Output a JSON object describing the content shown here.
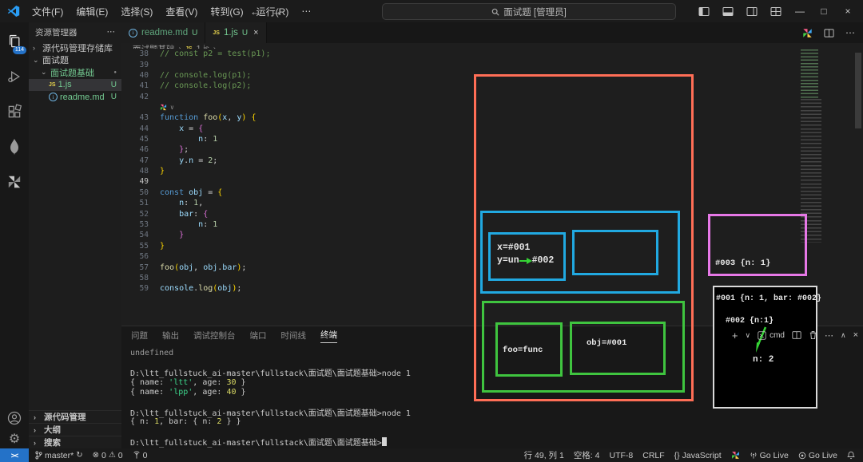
{
  "title_bar": {
    "menus": [
      "文件(F)",
      "编辑(E)",
      "选择(S)",
      "查看(V)",
      "转到(G)",
      "运行(R)",
      "⋯"
    ],
    "search_label": "面试题 [管理员]"
  },
  "icons": {
    "back": "←",
    "forward": "→",
    "more": "⋯",
    "chev_r": "›",
    "chev_d": "⌄",
    "vee": "∨",
    "caret": "∧",
    "close": "×",
    "minimize": "—",
    "maximize": "□",
    "plus": "+",
    "gear": "⚙",
    "warning": "⚠",
    "error": "⊗",
    "sync": "↻",
    "dot": "●",
    "js_badge": "JS",
    "info": "i"
  },
  "activity_bar": {
    "badge": "114"
  },
  "sidebar": {
    "header": "资源管理器",
    "tree": [
      {
        "id": "repos",
        "label": "源代码管理存储库",
        "arrow": "›",
        "depth": 0,
        "color": "gray"
      },
      {
        "id": "mianshiti",
        "label": "面试题",
        "arrow": "⌄",
        "depth": 0,
        "color": "light"
      },
      {
        "id": "mianshiti-jichu",
        "label": "面试题基础",
        "arrow": "⌄",
        "depth": 1,
        "color": "green",
        "dot": true
      },
      {
        "id": "1js",
        "label": "1.js",
        "icon": "js",
        "depth": 2,
        "color": "green",
        "badge": "U",
        "selected": true
      },
      {
        "id": "readme",
        "label": "readme.md",
        "icon": "info",
        "depth": 2,
        "color": "green",
        "badge": "U"
      }
    ],
    "bottom_sections": [
      "源代码管理",
      "大纲",
      "搜索"
    ]
  },
  "tabs": [
    {
      "label": "readme.md",
      "icon": "info",
      "badge": "U",
      "active": false
    },
    {
      "label": "1.js",
      "icon": "js",
      "badge": "U",
      "active": true
    }
  ],
  "breadcrumb": {
    "items": [
      "面试题基础",
      "1.js",
      "..."
    ],
    "sep": "›"
  },
  "editor": {
    "lines": [
      {
        "n": "38",
        "seg": [
          [
            "com",
            "// const p2 = test(p1);"
          ]
        ]
      },
      {
        "n": "39",
        "seg": []
      },
      {
        "n": "40",
        "seg": [
          [
            "com",
            "// console.log(p1);"
          ]
        ]
      },
      {
        "n": "41",
        "seg": [
          [
            "com",
            "// console.log(p2);"
          ]
        ]
      },
      {
        "n": "42",
        "seg": []
      },
      {
        "icon_row": true
      },
      {
        "n": "43",
        "seg": [
          [
            "kw",
            "function "
          ],
          [
            "fn",
            "foo"
          ],
          [
            "b1",
            "("
          ],
          [
            "var",
            "x"
          ],
          [
            "pun",
            ", "
          ],
          [
            "var",
            "y"
          ],
          [
            "b1",
            ")"
          ],
          [
            "pun",
            " "
          ],
          [
            "b1",
            "{"
          ]
        ]
      },
      {
        "n": "44",
        "seg": [
          [
            "pun",
            "    "
          ],
          [
            "var",
            "x"
          ],
          [
            "pun",
            " = "
          ],
          [
            "b2",
            "{"
          ]
        ]
      },
      {
        "n": "45",
        "seg": [
          [
            "pun",
            "        "
          ],
          [
            "var",
            "n"
          ],
          [
            "pun",
            ": "
          ],
          [
            "num",
            "1"
          ]
        ]
      },
      {
        "n": "46",
        "seg": [
          [
            "pun",
            "    "
          ],
          [
            "b2",
            "}"
          ],
          [
            "pun",
            ";"
          ]
        ]
      },
      {
        "n": "47",
        "seg": [
          [
            "pun",
            "    "
          ],
          [
            "var",
            "y"
          ],
          [
            "pun",
            "."
          ],
          [
            "var",
            "n"
          ],
          [
            "pun",
            " = "
          ],
          [
            "num",
            "2"
          ],
          [
            "pun",
            ";"
          ]
        ]
      },
      {
        "n": "48",
        "seg": [
          [
            "b1",
            "}"
          ]
        ]
      },
      {
        "n": "49",
        "seg": [],
        "active": true
      },
      {
        "n": "50",
        "seg": [
          [
            "kw",
            "const "
          ],
          [
            "var",
            "obj"
          ],
          [
            "pun",
            " = "
          ],
          [
            "b1",
            "{"
          ]
        ]
      },
      {
        "n": "51",
        "seg": [
          [
            "pun",
            "    "
          ],
          [
            "var",
            "n"
          ],
          [
            "pun",
            ": "
          ],
          [
            "num",
            "1"
          ],
          [
            "pun",
            ","
          ]
        ]
      },
      {
        "n": "52",
        "seg": [
          [
            "pun",
            "    "
          ],
          [
            "var",
            "bar"
          ],
          [
            "pun",
            ": "
          ],
          [
            "b2",
            "{"
          ]
        ]
      },
      {
        "n": "53",
        "seg": [
          [
            "pun",
            "        "
          ],
          [
            "var",
            "n"
          ],
          [
            "pun",
            ": "
          ],
          [
            "num",
            "1"
          ]
        ]
      },
      {
        "n": "54",
        "seg": [
          [
            "pun",
            "    "
          ],
          [
            "b2",
            "}"
          ]
        ]
      },
      {
        "n": "55",
        "seg": [
          [
            "b1",
            "}"
          ]
        ]
      },
      {
        "n": "56",
        "seg": []
      },
      {
        "n": "57",
        "seg": [
          [
            "fn",
            "foo"
          ],
          [
            "b1",
            "("
          ],
          [
            "var",
            "obj"
          ],
          [
            "pun",
            ", "
          ],
          [
            "var",
            "obj"
          ],
          [
            "pun",
            "."
          ],
          [
            "var",
            "bar"
          ],
          [
            "b1",
            ")"
          ],
          [
            "pun",
            ";"
          ]
        ]
      },
      {
        "n": "58",
        "seg": []
      },
      {
        "n": "59",
        "seg": [
          [
            "var",
            "console"
          ],
          [
            "pun",
            "."
          ],
          [
            "fn",
            "log"
          ],
          [
            "b1",
            "("
          ],
          [
            "var",
            "obj"
          ],
          [
            "b1",
            ")"
          ],
          [
            "pun",
            ";"
          ]
        ]
      }
    ]
  },
  "annotations": {
    "colors": {
      "orange": "#ff6e56",
      "blue": "#21a9e1",
      "green": "#3fc43f",
      "magenta": "#e678e6"
    },
    "blue_left_line1": "x=#001",
    "blue_left_line2a": "y=un",
    "blue_left_line2b": "#002",
    "green_left": "foo=func",
    "green_right": "obj=#001",
    "magenta_text": "#003 {n: 1}",
    "panel_line1": "#001 {n: 1, bar: #002}",
    "panel_line2": "#002 {n:1}",
    "panel_line3": "n: 2"
  },
  "panel": {
    "tabs": [
      {
        "label": "问题"
      },
      {
        "label": "输出"
      },
      {
        "label": "调试控制台"
      },
      {
        "label": "端口"
      },
      {
        "label": "时间线"
      },
      {
        "label": "终端",
        "active": true
      }
    ],
    "toolbar": {
      "cmd_label": "cmd"
    },
    "terminal": [
      {
        "seg": [
          [
            "dim",
            "undefined"
          ]
        ]
      },
      {
        "seg": []
      },
      {
        "seg": [
          [
            "t",
            "D:\\ltt_fullstuck_ai-master\\fullstack\\面试题\\面试题基础>node 1"
          ]
        ]
      },
      {
        "seg": [
          [
            "t",
            "{ name: "
          ],
          [
            "str",
            "'ltt'"
          ],
          [
            "t",
            ", age: "
          ],
          [
            "tn",
            "30"
          ],
          [
            "t",
            " }"
          ]
        ]
      },
      {
        "seg": [
          [
            "t",
            "{ name: "
          ],
          [
            "str",
            "'lpp'"
          ],
          [
            "t",
            ", age: "
          ],
          [
            "tn",
            "40"
          ],
          [
            "t",
            " }"
          ]
        ]
      },
      {
        "seg": []
      },
      {
        "seg": [
          [
            "t",
            "D:\\ltt_fullstuck_ai-master\\fullstack\\面试题\\面试题基础>node 1"
          ]
        ]
      },
      {
        "seg": [
          [
            "t",
            "{ n: "
          ],
          [
            "tn",
            "1"
          ],
          [
            "t",
            ", bar: { n: "
          ],
          [
            "tn",
            "2"
          ],
          [
            "t",
            " } }"
          ]
        ]
      },
      {
        "seg": []
      },
      {
        "seg": [
          [
            "t",
            "D:\\ltt_fullstuck_ai-master\\fullstack\\面试题\\面试题基础>"
          ],
          [
            "cursor",
            " "
          ]
        ]
      }
    ]
  },
  "status_bar": {
    "remote": "><",
    "branch": "master*",
    "errors": "0",
    "warnings": "0",
    "ports": "0",
    "line_col": "行 49, 列 1",
    "spaces": "空格: 4",
    "encoding": "UTF-8",
    "eol": "CRLF",
    "language": "{} JavaScript",
    "golive1": "Go Live",
    "golive2": "Go Live"
  }
}
